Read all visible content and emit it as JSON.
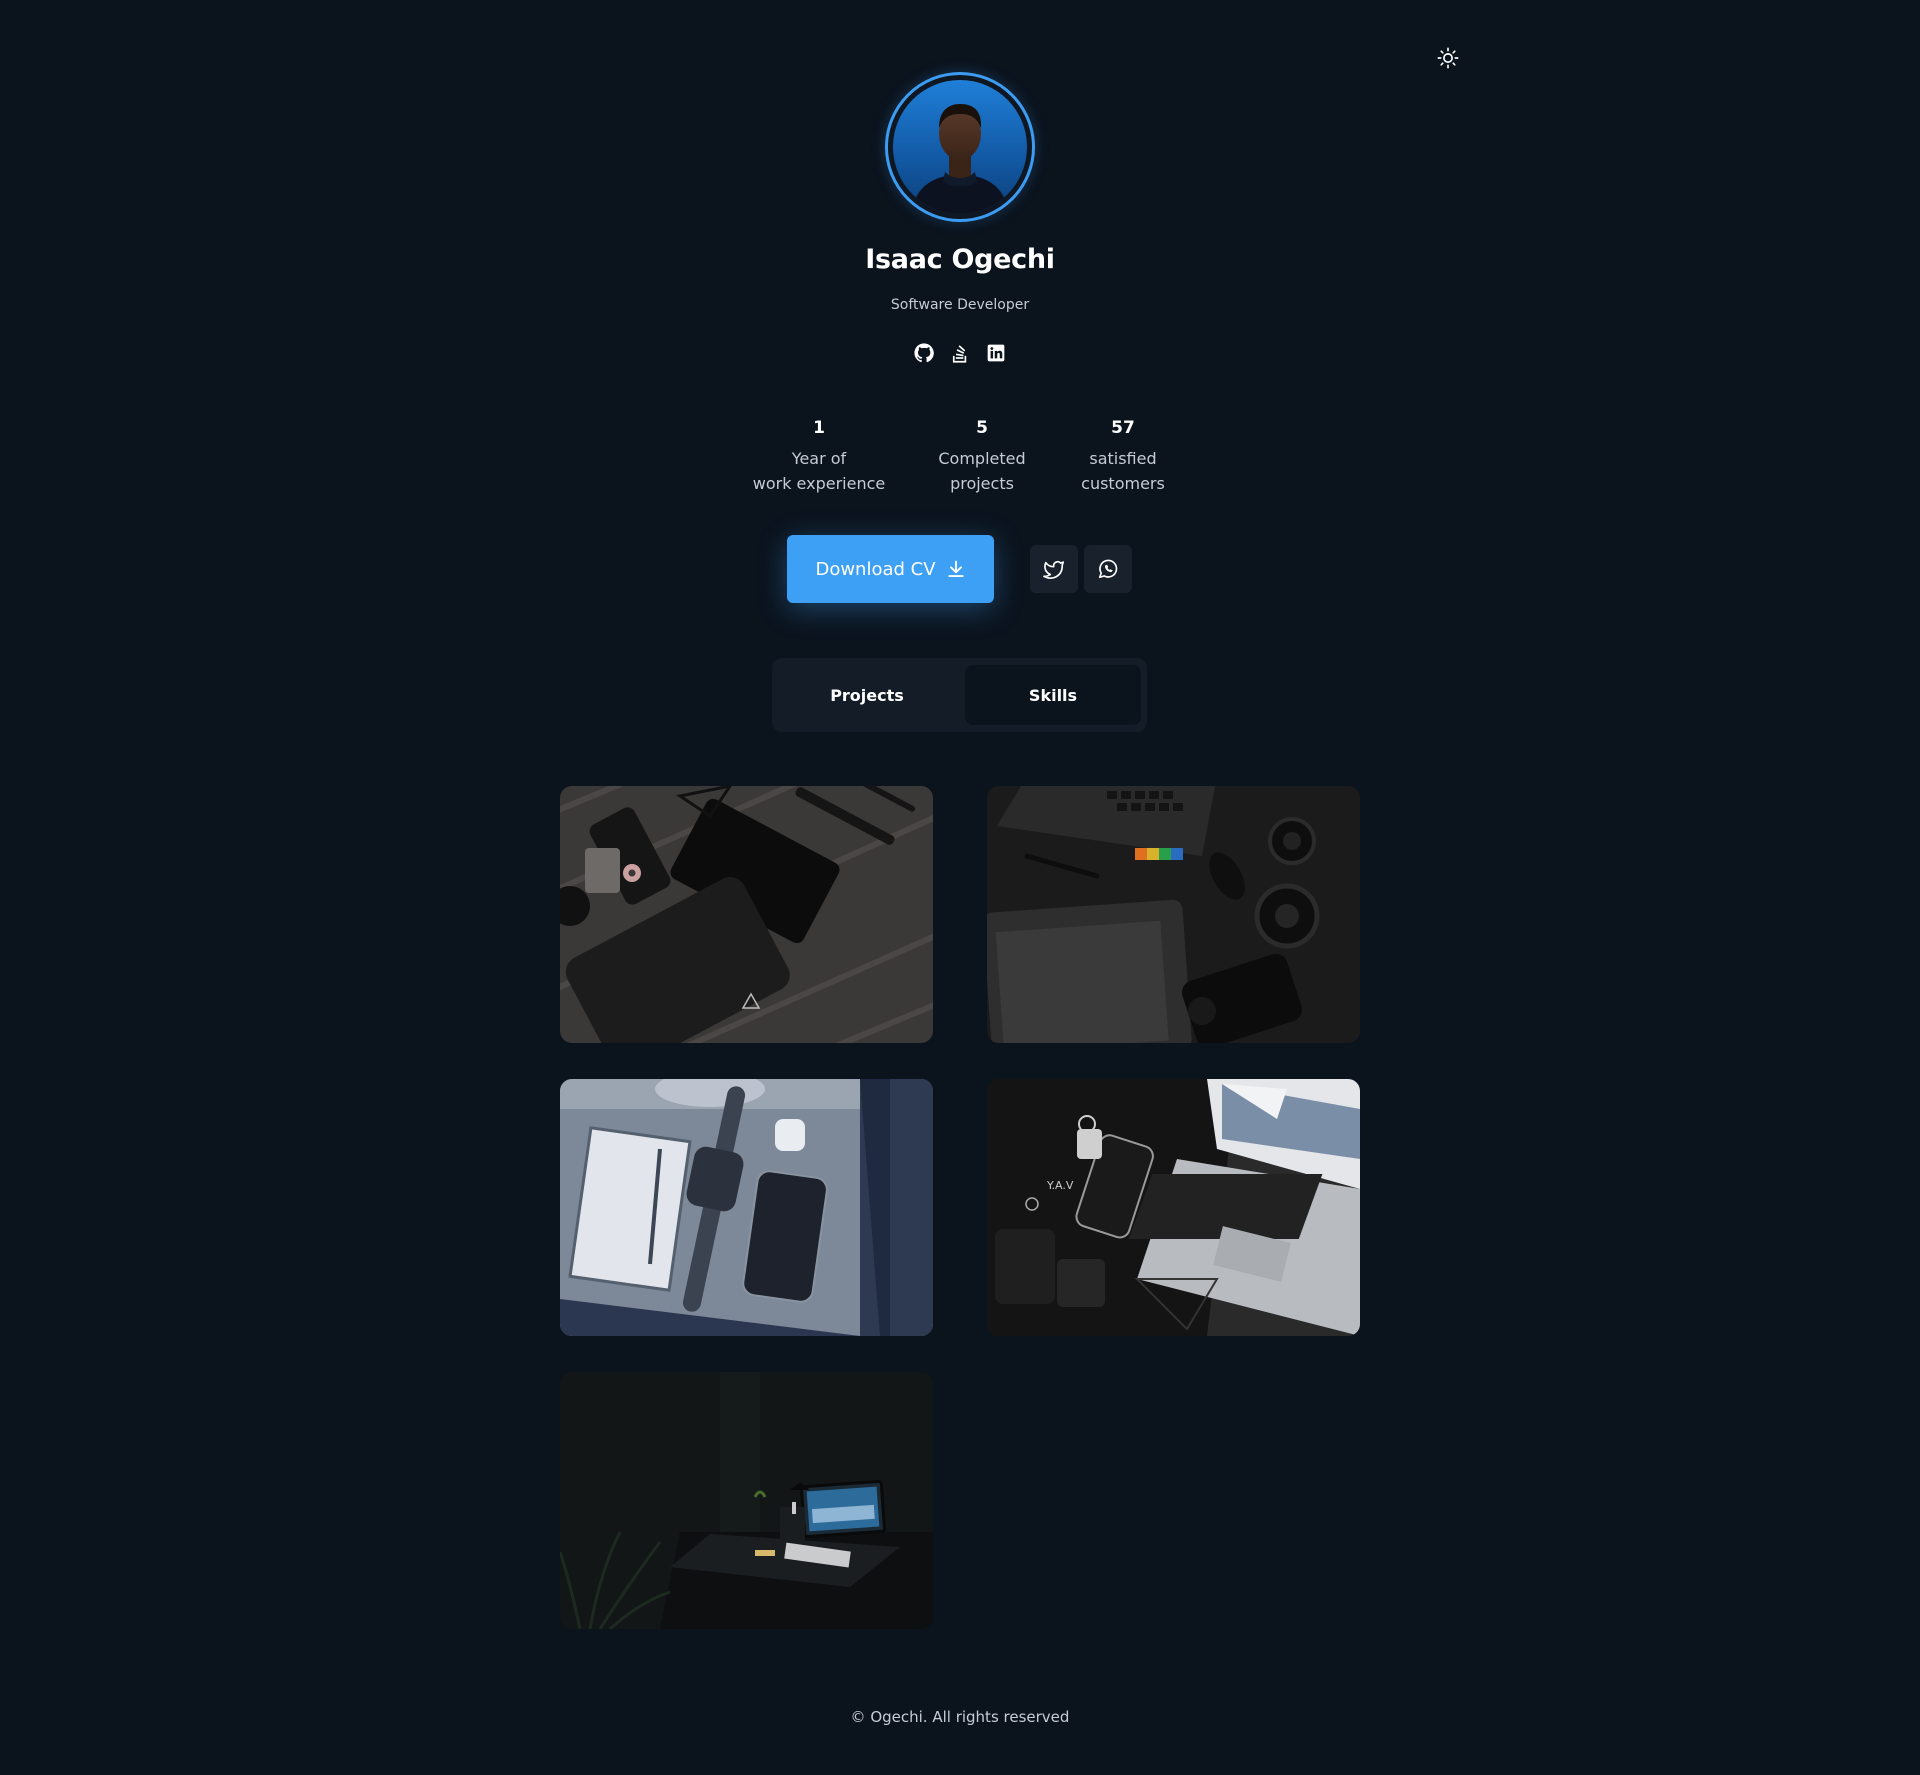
{
  "profile": {
    "name": "Isaac Ogechi",
    "role": "Software Developer"
  },
  "icons": {
    "theme_toggle": "sun-icon",
    "socials": [
      "github-icon",
      "stackoverflow-icon",
      "linkedin-icon"
    ],
    "download": "download-icon",
    "contact": [
      "twitter-icon",
      "whatsapp-icon"
    ]
  },
  "stats": [
    {
      "value": "1",
      "label_line1": "Year of",
      "label_line2": "work experience"
    },
    {
      "value": "5",
      "label_line1": "Completed",
      "label_line2": "projects"
    },
    {
      "value": "57",
      "label_line1": "satisfied",
      "label_line2": "customers"
    }
  ],
  "actions": {
    "download_label": "Download CV"
  },
  "tabs": [
    {
      "label": "Projects",
      "active": false
    },
    {
      "label": "Skills",
      "active": true
    }
  ],
  "footer": {
    "text": "© Ogechi. All rights reserved"
  },
  "colors": {
    "background": "#0b131d",
    "accent": "#3ea0f5",
    "panel": "#141c27",
    "muted_text": "#c6ccd6"
  }
}
